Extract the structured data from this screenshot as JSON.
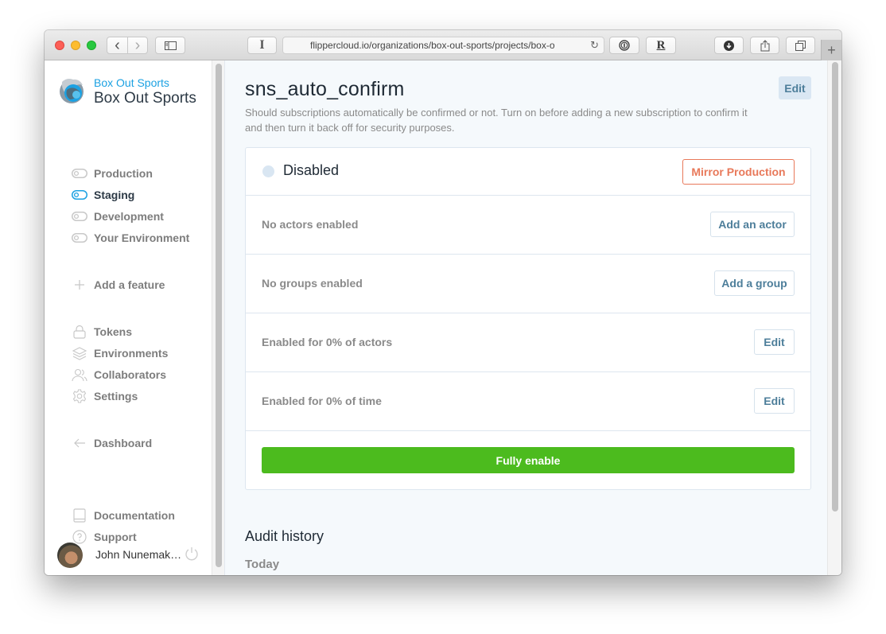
{
  "browser": {
    "url": "flippercloud.io/organizations/box-out-sports/projects/box-o",
    "icons": [
      "back-icon",
      "forward-icon",
      "sidebar-icon",
      "reader-icon",
      "reload-icon",
      "onepassword-icon",
      "r-extension-icon",
      "download-icon",
      "share-icon",
      "tabs-icon",
      "new-tab-icon"
    ],
    "back_glyph": "‹",
    "forward_glyph": "›",
    "reader_glyph": "I",
    "r_ext_glyph": "R",
    "reload_glyph": "↻",
    "new_tab_glyph": "+"
  },
  "sidebar": {
    "org_small": "Box Out Sports",
    "org_big": "Box Out Sports",
    "environments": [
      {
        "label": "Production",
        "active": false
      },
      {
        "label": "Staging",
        "active": true
      },
      {
        "label": "Development",
        "active": false
      },
      {
        "label": "Your Environment",
        "active": false
      }
    ],
    "add_feature": "Add a feature",
    "settings_items": [
      {
        "label": "Tokens",
        "icon": "lock-icon"
      },
      {
        "label": "Environments",
        "icon": "layers-icon"
      },
      {
        "label": "Collaborators",
        "icon": "users-icon"
      },
      {
        "label": "Settings",
        "icon": "gear-icon"
      }
    ],
    "dashboard": "Dashboard",
    "help_items": [
      {
        "label": "Documentation",
        "icon": "book-icon"
      },
      {
        "label": "Support",
        "icon": "help-circle-icon"
      }
    ],
    "user_name": "John Nunemak…"
  },
  "feature": {
    "name": "sns_auto_confirm",
    "description": "Should subscriptions automatically be confirmed or not. Turn on before adding a new subscription to confirm it and then turn it back off for security purposes.",
    "edit_label": "Edit",
    "status": "Disabled",
    "mirror_label": "Mirror Production",
    "rows": [
      {
        "label": "No actors enabled",
        "button": "Add an actor"
      },
      {
        "label": "No groups enabled",
        "button": "Add a group"
      },
      {
        "label": "Enabled for 0% of actors",
        "button": "Edit"
      },
      {
        "label": "Enabled for 0% of time",
        "button": "Edit"
      }
    ],
    "fully_enable_label": "Fully enable"
  },
  "audit": {
    "title": "Audit history",
    "today": "Today"
  },
  "colors": {
    "accent": "#1ba1e2",
    "green": "#4cbb1e",
    "mirror": "#e8795a",
    "button_text": "#4d7e9a"
  }
}
